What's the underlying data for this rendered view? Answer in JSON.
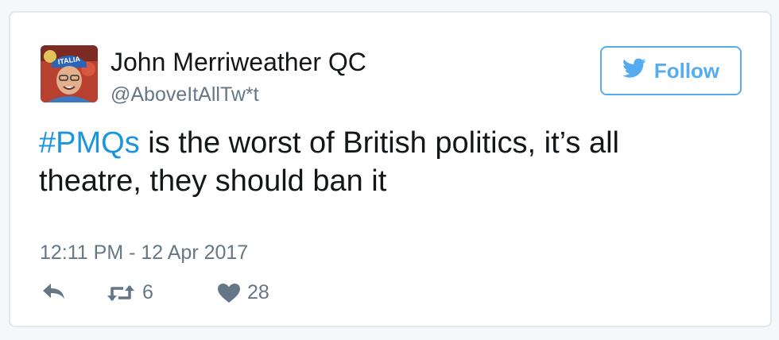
{
  "author": {
    "display_name": "John Merriweather QC",
    "handle": "@AboveItAllTw*t",
    "avatar_icon": "user-avatar",
    "avatar_cap_text": "ITALIA"
  },
  "follow": {
    "label": "Follow",
    "icon": "twitter-bird-icon",
    "color": "#55acee"
  },
  "tweet": {
    "hashtag": "#PMQs",
    "text": " is the worst of British politics, it’s all theatre, they should ban it",
    "hashtag_color": "#1b95e0"
  },
  "timestamp": "12:11 PM - 12 Apr 2017",
  "actions": {
    "reply": {
      "icon": "reply-icon"
    },
    "retweet": {
      "icon": "retweet-icon",
      "count": "6"
    },
    "like": {
      "icon": "heart-icon",
      "count": "28"
    }
  }
}
